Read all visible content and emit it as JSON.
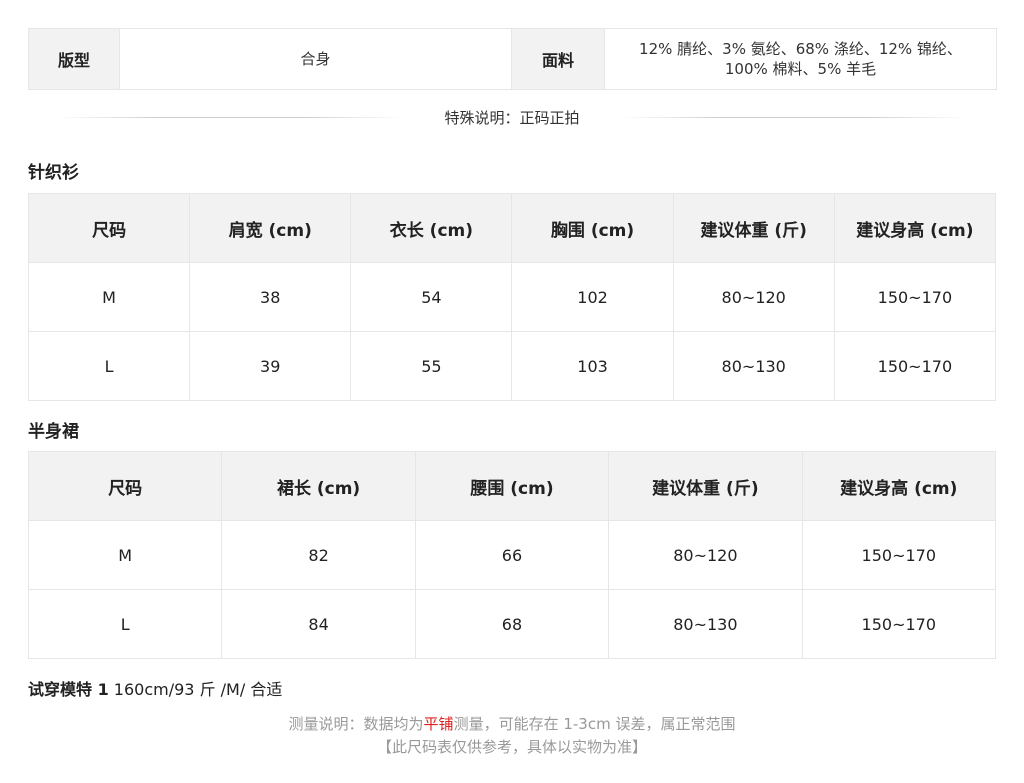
{
  "attributes": {
    "fit_label": "版型",
    "fit_value": "合身",
    "fabric_label": "面料",
    "fabric_line1": "12% 腈纶、3% 氨纶、68% 涤纶、12% 锦纶、",
    "fabric_line2": "100% 棉料、5% 羊毛"
  },
  "special_note": "特殊说明：正码正拍",
  "knit": {
    "title": "针织衫",
    "headers": [
      "尺码",
      "肩宽 (cm)",
      "衣长 (cm)",
      "胸围 (cm)",
      "建议体重 (斤)",
      "建议身高 (cm)"
    ],
    "rows": [
      [
        "M",
        "38",
        "54",
        "102",
        "80~120",
        "150~170"
      ],
      [
        "L",
        "39",
        "55",
        "103",
        "80~130",
        "150~170"
      ]
    ]
  },
  "skirt": {
    "title": "半身裙",
    "headers": [
      "尺码",
      "裙长 (cm)",
      "腰围 (cm)",
      "建议体重 (斤)",
      "建议身高 (cm)"
    ],
    "rows": [
      [
        "M",
        "82",
        "66",
        "80~120",
        "150~170"
      ],
      [
        "L",
        "84",
        "68",
        "80~130",
        "150~170"
      ]
    ]
  },
  "model": {
    "label": "试穿模特 1",
    "value": " 160cm/93 斤 /M/ 合适"
  },
  "footer": {
    "line1_prefix": "测量说明：数据均为",
    "line1_highlight": "平铺",
    "line1_suffix": "测量，可能存在 1-3cm 误差，属正常范围",
    "line2": "【此尺码表仅供参考，具体以实物为准】",
    "highlight_color": "#e02020"
  }
}
